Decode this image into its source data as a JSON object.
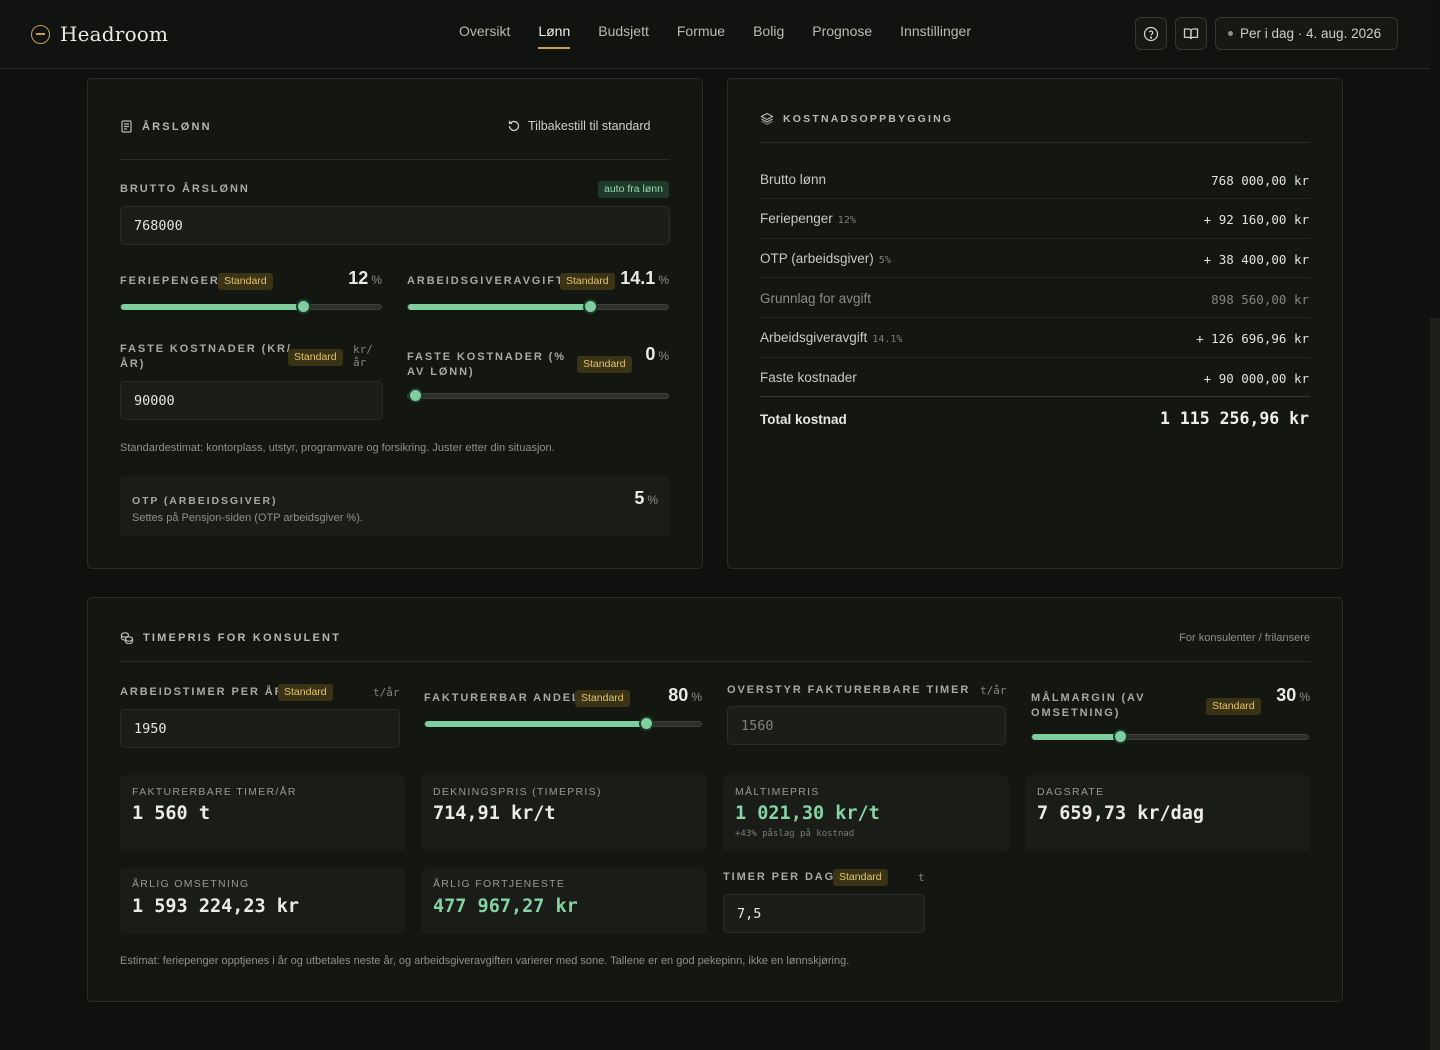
{
  "app": {
    "name": "Headroom"
  },
  "nav": [
    {
      "label": "Oversikt"
    },
    {
      "label": "Lønn"
    },
    {
      "label": "Budsjett"
    },
    {
      "label": "Formue"
    },
    {
      "label": "Bolig"
    },
    {
      "label": "Prognose"
    },
    {
      "label": "Innstillinger"
    }
  ],
  "nav_active": "Lønn",
  "header": {
    "date_label": "Per i dag · 4. aug. 2026",
    "help_icon": "help-circle-icon",
    "docs_icon": "book-open-icon"
  },
  "colors": {
    "accent": "#c9a052",
    "positive": "#7fcf9e",
    "badge_bg": "#3a3316",
    "badge_text": "#e3c46a"
  },
  "salary": {
    "title": "ÅRSLØNN",
    "reset_label": "Tilbakestill til standard",
    "gross_label": "BRUTTO ÅRSLØNN",
    "gross_badge": "auto fra lønn",
    "gross_value": "768000",
    "holiday": {
      "label": "FERIEPENGER",
      "badge": "Standard",
      "value": "12",
      "unit": "%",
      "fraction": 0.7
    },
    "employer_tax": {
      "label": "ARBEIDSGIVERAVGIFT",
      "badge": "Standard",
      "value": "14.1",
      "unit": "%",
      "fraction": 0.7
    },
    "fixed_kr": {
      "label_1": "FASTE KOSTNADER (KR/",
      "label_2": "ÅR)",
      "badge": "Standard",
      "unit_1": "kr/",
      "unit_2": "år",
      "value": "90000"
    },
    "fixed_pct": {
      "label_1": "FASTE KOSTNADER (%",
      "label_2": "AV LØNN)",
      "badge": "Standard",
      "value": "0",
      "unit": "%",
      "fraction": 0.0
    },
    "estimate_note": "Standardestimat: kontorplass, utstyr, programvare og forsikring. Juster etter din situasjon.",
    "otp": {
      "label": "OTP (ARBEIDSGIVER)",
      "sub": "Settes på Pensjon-siden (OTP arbeidsgiver %).",
      "value": "5",
      "unit": "%"
    }
  },
  "cost": {
    "title": "KOSTNADSOPPBYGGING",
    "rows": [
      {
        "label": "Brutto lønn",
        "sub": "",
        "value": "768 000,00 kr"
      },
      {
        "label": "Feriepenger",
        "sub": "12%",
        "value": "+ 92 160,00 kr"
      },
      {
        "label": "OTP (arbeidsgiver)",
        "sub": "5%",
        "value": "+ 38 400,00 kr"
      },
      {
        "label": "Grunnlag for avgift",
        "sub": "",
        "value": "898 560,00 kr"
      },
      {
        "label": "Arbeidsgiveravgift",
        "sub": "14.1%",
        "value": "+ 126 696,96 kr"
      },
      {
        "label": "Faste kostnader",
        "sub": "",
        "value": "+ 90 000,00 kr"
      }
    ],
    "total_label": "Total kostnad",
    "total_value": "1 115 256,96 kr"
  },
  "consultant": {
    "title": "TIMEPRIS FOR KONSULENT",
    "subtitle": "For konsulenter / frilansere",
    "hours": {
      "label": "ARBEIDSTIMER PER ÅR",
      "badge": "Standard",
      "unit": "t/år",
      "value": "1950"
    },
    "billable": {
      "label": "FAKTURERBAR ANDEL",
      "badge": "Standard",
      "value": "80",
      "unit": "%",
      "fraction": 0.8
    },
    "override": {
      "label": "OVERSTYR FAKTURERBARE TIMER",
      "unit": "t/år",
      "placeholder": "1560"
    },
    "margin": {
      "label_1": "MÅLMARGIN (AV",
      "label_2": "OMSETNING)",
      "badge": "Standard",
      "value": "30",
      "unit": "%",
      "fraction": 0.32
    },
    "stats": [
      {
        "label": "FAKTURERBARE TIMER/ÅR",
        "value": "1 560 t"
      },
      {
        "label": "DEKNINGSPRIS (TIMEPRIS)",
        "value": "714,91 kr/t"
      },
      {
        "label": "MÅLTIMEPRIS",
        "value": "1 021,30 kr/t",
        "sub": "+43% påslag på kostnad"
      },
      {
        "label": "DAGSRATE",
        "value": "7 659,73 kr/dag"
      },
      {
        "label": "ÅRLIG OMSETNING",
        "value": "1 593 224,23 kr"
      },
      {
        "label": "ÅRLIG FORTJENESTE",
        "value": "477 967,27 kr"
      }
    ],
    "per_day": {
      "label": "TIMER PER DAG",
      "badge": "Standard",
      "unit": "t",
      "value": "7,5"
    },
    "footer_note": "Estimat: feriepenger opptjenes i år og utbetales neste år, og arbeidsgiveravgiften varierer med sone. Tallene er en god pekepinn, ikke en lønnskjøring."
  }
}
